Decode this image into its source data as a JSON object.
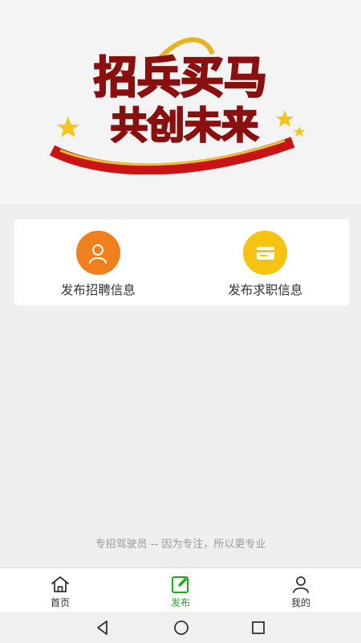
{
  "banner": {
    "line1": "招兵买马",
    "line2": "共创未来"
  },
  "actions": [
    {
      "label": "发布招聘信息",
      "icon": "user-icon",
      "color": "#f0801d"
    },
    {
      "label": "发布求职信息",
      "icon": "card-icon",
      "color": "#f7c313"
    }
  ],
  "slogan": "专招驾驶员 -- 因为专注，所以更专业",
  "tabs": [
    {
      "label": "首页",
      "icon": "home-icon",
      "active": false
    },
    {
      "label": "发布",
      "icon": "edit-icon",
      "active": true
    },
    {
      "label": "我的",
      "icon": "person-icon",
      "active": false
    }
  ],
  "colors": {
    "accent": "#1aad19",
    "orange": "#f0801d",
    "yellow": "#f7c313"
  },
  "system_nav": [
    "back-icon",
    "home-circle-icon",
    "recents-icon"
  ]
}
